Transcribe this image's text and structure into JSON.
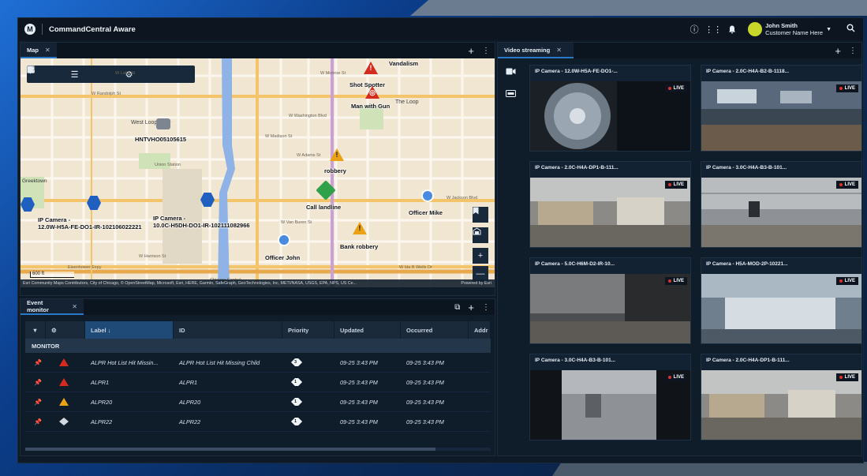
{
  "app": {
    "title": "CommandCentral Aware",
    "logo_glyph": "M"
  },
  "user": {
    "name": "John Smith",
    "org": "Customer Name Here"
  },
  "topbar_icons": [
    "info-icon",
    "apps-grid-icon",
    "bell-icon",
    "search-icon"
  ],
  "map_panel": {
    "tab_label": "Map",
    "toolbar_icons": [
      "layers-icon",
      "search-icon",
      "list-icon",
      "measure-icon",
      "pin-icon",
      "gear-icon",
      "route-icon",
      "select-area-icon",
      "fullscreen-icon"
    ],
    "labels": {
      "vandalism": "Vandalism",
      "shot_spotter": "Shot Spotter",
      "man_with_gun": "Man with Gun",
      "hntv": "HNTVHO05105615",
      "robbery": "robbery",
      "call_landline": "Call landline",
      "officer_mike": "Officer Mike",
      "cam1": "IP Camera -\n12.0W-H5A-FE-DO1-IR-102106022221",
      "cam2": "IP Camera -\n10.0C-H5DH-DO1-IR-102111082966",
      "bank_robbery": "Bank robbery",
      "officer_john": "Officer John"
    },
    "streets": [
      "W Lake St",
      "W Randolph St",
      "W Washington Blvd",
      "W Madison St",
      "W Monroe St",
      "W Adams St",
      "W Jackson Blvd",
      "W Van Buren St",
      "W Harrison St",
      "Eisenhower Expy",
      "W Ida B Wells Dr",
      "The Loop",
      "West Loop Gate",
      "Greektown",
      "Union Station",
      "Chicago Central"
    ],
    "scale": "600 ft",
    "attribution": "Esri Community Maps Contributors, City of Chicago, © OpenStreetMap, Microsoft, Esri, HERE, Garmin, SafeGraph, GeoTechnologies, Inc, METI/NASA, USGS, EPA, NPS, US Ce...",
    "powered_by": "Powered by Esri"
  },
  "event_monitor": {
    "tab_label": "Event monitor",
    "columns": [
      "Label",
      "ID",
      "Priority",
      "Updated",
      "Occurred",
      "Addr"
    ],
    "sort_arrow": "↓",
    "group_label": "MONITOR",
    "rows": [
      {
        "icon": "red",
        "label": "ALPR Hot List Hit Missin...",
        "id": "ALPR Hot List Hit Missing Child",
        "priority": "3",
        "updated": "09-25 3:43 PM",
        "occurred": "09-25 3:43 PM"
      },
      {
        "icon": "red",
        "label": "ALPR1",
        "id": "ALPR1",
        "priority": "1",
        "updated": "09-25 3:43 PM",
        "occurred": "09-25 3:43 PM"
      },
      {
        "icon": "orange",
        "label": "ALPR20",
        "id": "ALPR20",
        "priority": "1",
        "updated": "09-25 3:43 PM",
        "occurred": "09-25 3:43 PM"
      },
      {
        "icon": "gray",
        "label": "ALPR22",
        "id": "ALPR22",
        "priority": "1",
        "updated": "09-25 3:43 PM",
        "occurred": "09-25 3:43 PM"
      }
    ]
  },
  "video_panel": {
    "tab_label": "Video streaming",
    "live_label": "LIVE",
    "cameras": [
      {
        "title": "IP Camera - 12.0W-H5A-FE-DO1-...",
        "scene": "fisheye"
      },
      {
        "title": "IP Camera - 2.0C-H4A-B2-B-1118...",
        "scene": "office"
      },
      {
        "title": "IP Camera - 2.0C-H4A-DP1-B-111...",
        "scene": "desks"
      },
      {
        "title": "IP Camera - 3.0C-H4A-B3-B-101...",
        "scene": "ceiling"
      },
      {
        "title": "IP Camera - 5.0C-H6M-D2-IR-10...",
        "scene": "dark"
      },
      {
        "title": "IP Camera - H5A-MOD-2P-10221...",
        "scene": "wide"
      },
      {
        "title": "IP Camera - 3.0C-H4A-B3-B-101...",
        "scene": "hall"
      },
      {
        "title": "IP Camera - 2.0C-H4A-DP1-B-111...",
        "scene": "desks"
      }
    ]
  },
  "colors": {
    "accent": "#2a78c8",
    "alert_red": "#d52b1e",
    "alert_orange": "#e9a115",
    "call_green": "#2fa14a",
    "live_red": "#e0302a"
  }
}
